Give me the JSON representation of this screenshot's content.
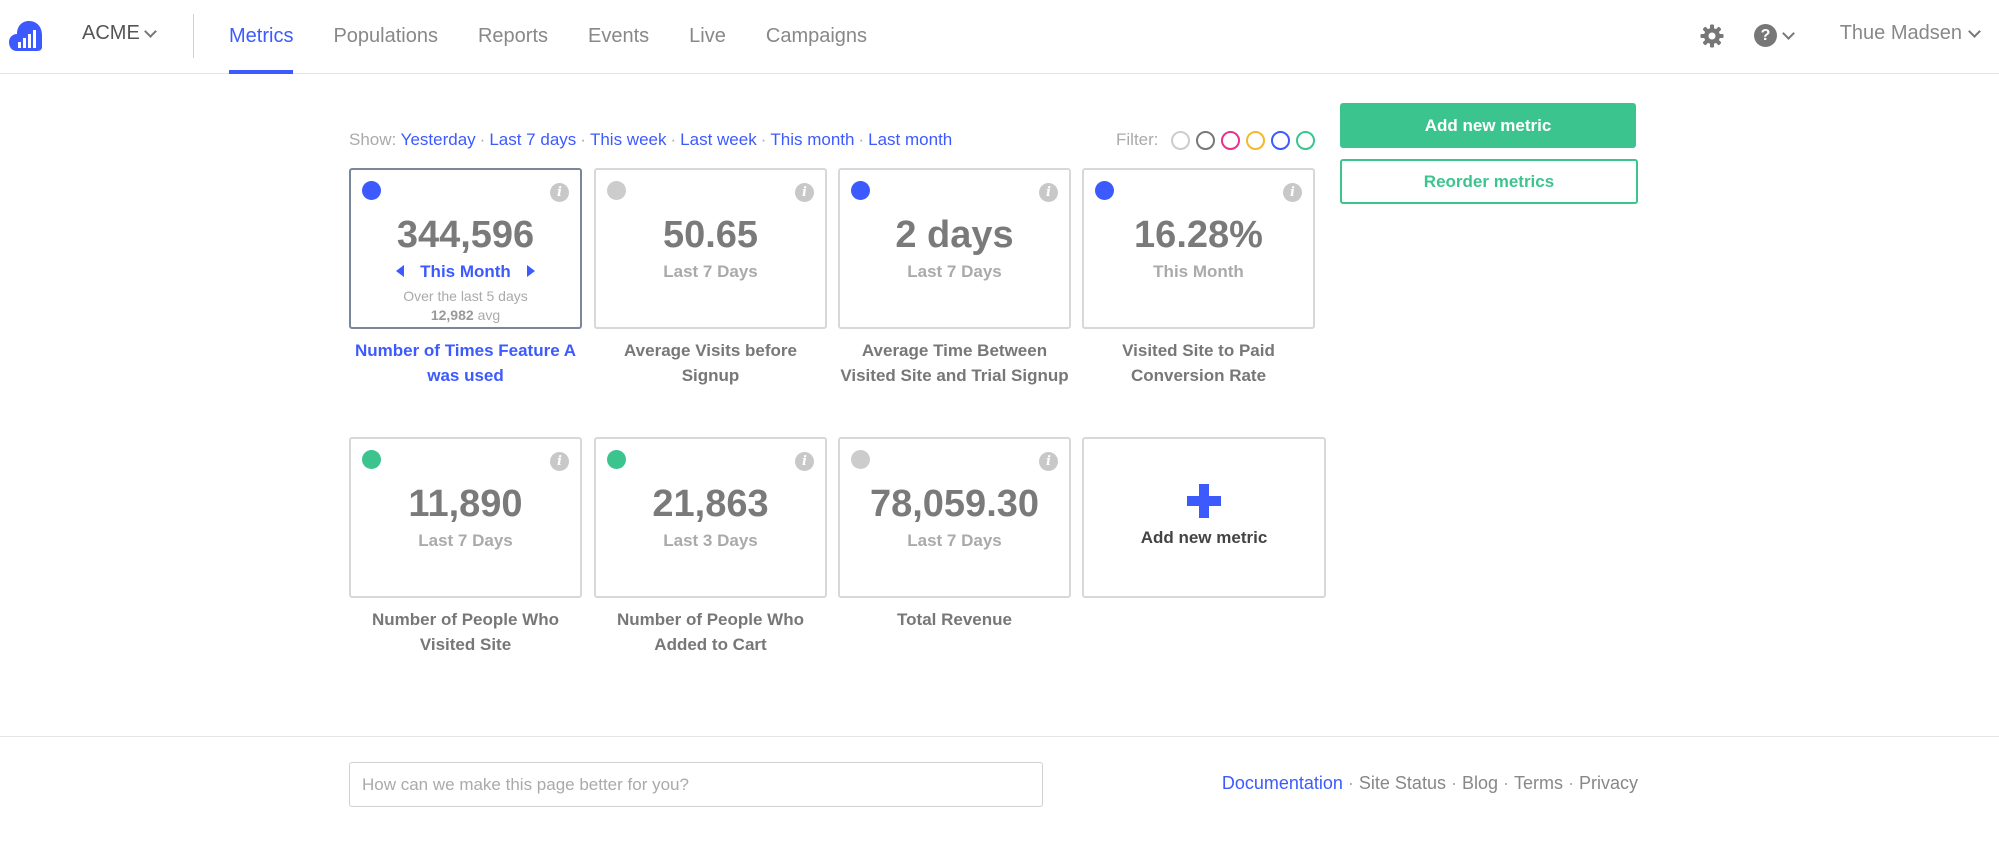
{
  "header": {
    "org_name": "ACME",
    "tabs": [
      {
        "label": "Metrics",
        "active": true
      },
      {
        "label": "Populations"
      },
      {
        "label": "Reports"
      },
      {
        "label": "Events"
      },
      {
        "label": "Live"
      },
      {
        "label": "Campaigns"
      }
    ],
    "user_name": "Thue Madsen",
    "help_glyph": "?",
    "icons": {
      "logo": "cloud-bars-logo",
      "settings": "gear-icon",
      "help": "question-circle-icon"
    }
  },
  "show": {
    "label": "Show:",
    "options": [
      "Yesterday",
      "Last 7 days",
      "This week",
      "Last week",
      "This month",
      "Last month"
    ]
  },
  "filter": {
    "label": "Filter:",
    "colors": [
      "#cccccc",
      "#777777",
      "#e8308c",
      "#f5b82e",
      "#3d5afe",
      "#3cc48f"
    ]
  },
  "actions": {
    "add_metric": "Add new metric",
    "reorder_metrics": "Reorder metrics"
  },
  "metrics": [
    {
      "value": "344,596",
      "period": "This Month",
      "sub_text": "Over the last 5 days",
      "avg_value": "12,982",
      "avg_label": "avg",
      "label": "Number of Times Feature A was used",
      "color": "#3d5afe",
      "info": "i"
    },
    {
      "value": "50.65",
      "period": "Last 7 Days",
      "label": "Average Visits before Signup",
      "color": "#cccccc",
      "info": "i"
    },
    {
      "value": "2 days",
      "period": "Last 7 Days",
      "label": "Average Time Between Visited Site and Trial Signup",
      "color": "#3d5afe",
      "info": "i"
    },
    {
      "value": "16.28%",
      "period": "This Month",
      "label": "Visited Site to Paid Conversion Rate",
      "color": "#3d5afe",
      "info": "i"
    },
    {
      "value": "11,890",
      "period": "Last 7 Days",
      "label": "Number of People Who Visited Site",
      "color": "#3cc48f",
      "info": "i"
    },
    {
      "value": "21,863",
      "period": "Last 3 Days",
      "label": "Number of People Who Added to Cart",
      "color": "#3cc48f",
      "info": "i"
    },
    {
      "value": "78,059.30",
      "period": "Last 7 Days",
      "label": "Total Revenue",
      "color": "#cccccc",
      "info": "i"
    }
  ],
  "add_card": {
    "label": "Add new metric"
  },
  "footer": {
    "feedback_placeholder": "How can we make this page better for you?",
    "links": [
      "Documentation",
      "Site Status",
      "Blog",
      "Terms",
      "Privacy"
    ],
    "separator": "·"
  }
}
